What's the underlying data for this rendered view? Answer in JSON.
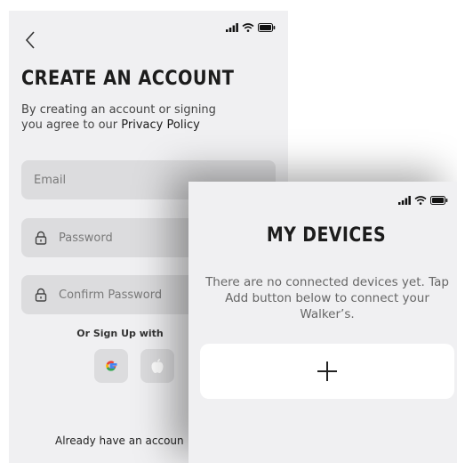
{
  "signup": {
    "title": "CREATE AN ACCOUNT",
    "subtitle_prefix": "By creating an account or signing you agree to our ",
    "privacy_link": "Privacy Policy",
    "email_placeholder": "Email",
    "password_placeholder": "Password",
    "confirm_placeholder": "Confirm Password",
    "or_signup": "Or Sign Up with",
    "already": "Already have an accoun"
  },
  "devices": {
    "title": "MY DEVICES",
    "empty_message": "There are no connected devices yet. Tap Add button below to connect your Walker’s."
  },
  "icons": {
    "back": "chevron-left-icon",
    "signal": "signal-icon",
    "wifi": "wifi-icon",
    "battery": "battery-icon",
    "lock": "lock-icon",
    "google": "google-icon",
    "apple": "apple-icon",
    "add": "plus-icon"
  },
  "colors": {
    "screen_bg": "#f0f0f2",
    "field_bg": "#dcdcde",
    "card_bg": "#ffffff",
    "text_dark": "#1c1c1c"
  }
}
